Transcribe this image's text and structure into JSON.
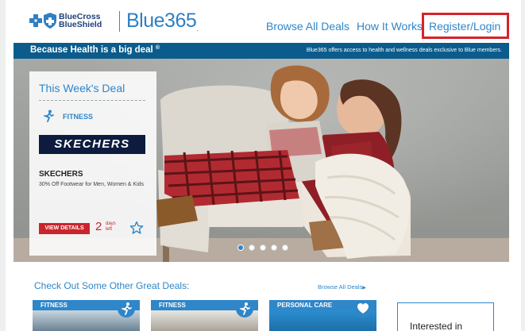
{
  "header": {
    "org_line1": "BlueCross",
    "org_line2": "BlueShield",
    "brand_name": "Blue365",
    "brand_mark": ".",
    "nav": [
      "Browse All Deals",
      "How It Works",
      "Register/Login"
    ]
  },
  "banner": {
    "tagline": "Because Health is a big deal",
    "tagline_mark": "®",
    "description": "Blue365 offers access to health and wellness deals exclusive to Blue members."
  },
  "hero": {
    "deal_panel": {
      "title": "This Week's Deal",
      "category": "FITNESS",
      "category_icon": "runner-icon",
      "brand_logo_text": "SKECHERS",
      "deal_name": "SKECHERS",
      "deal_description": "30% Off Footwear for Men, Women & Kids",
      "cta_label": "VIEW DETAILS",
      "days_count": "2",
      "days_label": "days left",
      "favorite_icon": "star-icon"
    },
    "carousel": {
      "slides": 5,
      "active_index": 0
    }
  },
  "other_deals": {
    "heading": "Check Out Some Other Great Deals:",
    "browse_label": "Browse All Deals",
    "browse_arrow": "▶",
    "cards": [
      {
        "category": "FITNESS",
        "icon": "runner-icon"
      },
      {
        "category": "FITNESS",
        "icon": "runner-icon"
      },
      {
        "category": "PERSONAL CARE",
        "icon": "heart-icon"
      }
    ],
    "interest_box_text": "Interested in"
  },
  "colors": {
    "accent_blue": "#2f86c8",
    "banner_blue": "#0b5c8c",
    "highlight_red": "#d6232b",
    "cta_red": "#c9252c",
    "logo_navy": "#0d1b3f"
  }
}
